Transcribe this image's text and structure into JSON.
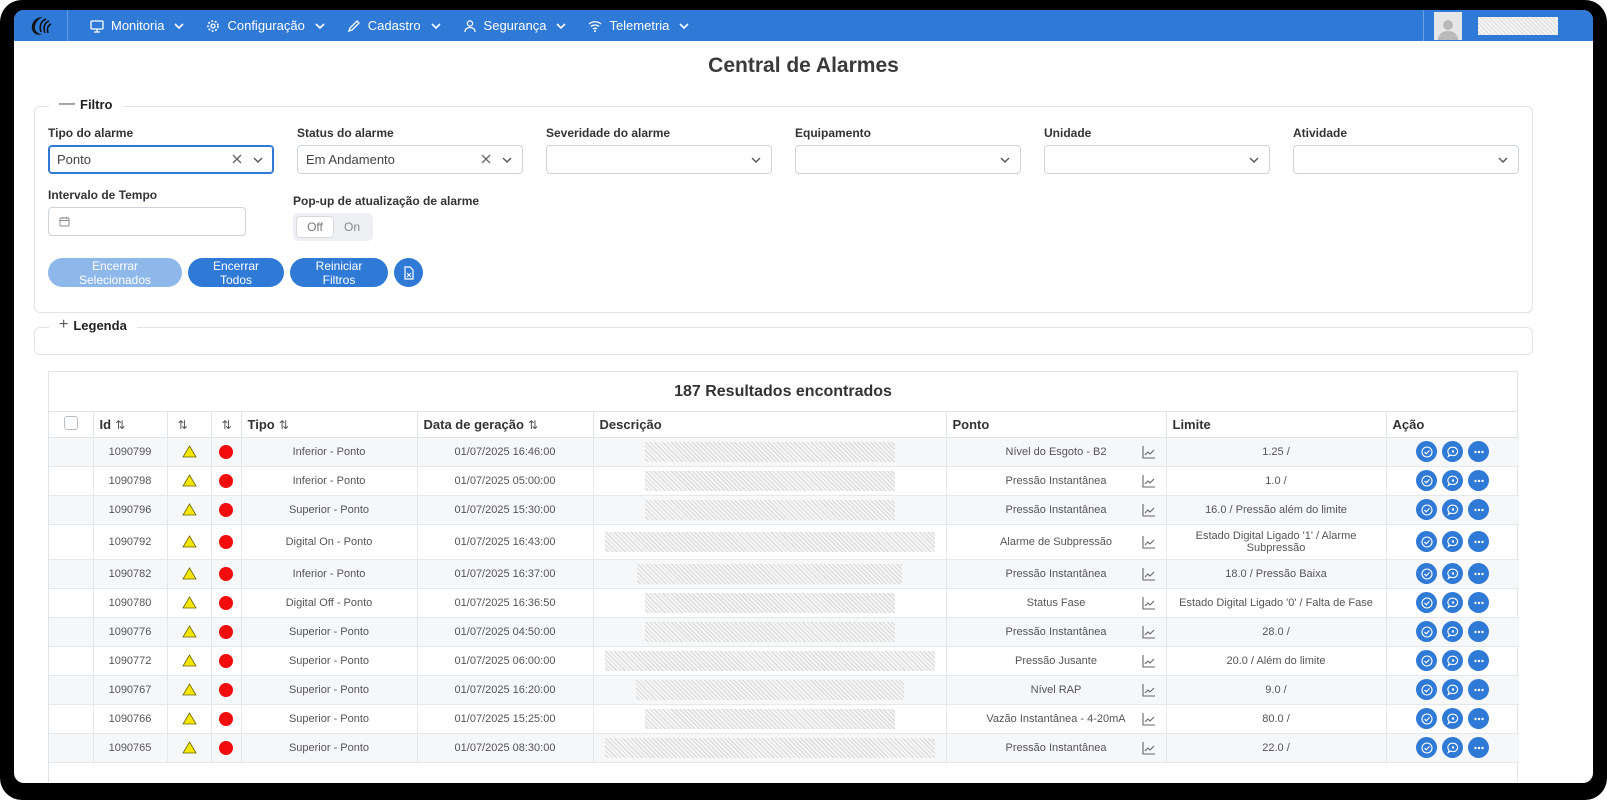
{
  "nav": {
    "items": [
      {
        "label": "Monitoria",
        "icon": "monitor-icon"
      },
      {
        "label": "Configuração",
        "icon": "gear-icon"
      },
      {
        "label": "Cadastro",
        "icon": "pencil-icon"
      },
      {
        "label": "Segurança",
        "icon": "user-icon"
      },
      {
        "label": "Telemetria",
        "icon": "wifi-icon"
      }
    ]
  },
  "page": {
    "title": "Central de Alarmes"
  },
  "filter": {
    "legend": "Filtro",
    "tipo": {
      "label": "Tipo do alarme",
      "value": "Ponto"
    },
    "status": {
      "label": "Status do alarme",
      "value": "Em Andamento"
    },
    "severidade": {
      "label": "Severidade do alarme",
      "value": ""
    },
    "equipamento": {
      "label": "Equipamento",
      "value": ""
    },
    "unidade": {
      "label": "Unidade",
      "value": ""
    },
    "atividade": {
      "label": "Atividade",
      "value": ""
    },
    "intervalo": {
      "label": "Intervalo de Tempo",
      "value": ""
    },
    "popup": {
      "label": "Pop-up de atualização de alarme",
      "off": "Off",
      "on": "On",
      "selected": "Off"
    },
    "buttons": {
      "encerrar_selecionados": "Encerrar Selecionados",
      "encerrar_todos": "Encerrar Todos",
      "reiniciar_filtros": "Reiniciar Filtros"
    }
  },
  "legenda": {
    "legend": "Legenda"
  },
  "table": {
    "results": "187 Resultados encontrados",
    "columns": {
      "id": "Id",
      "tipo": "Tipo",
      "data": "Data de geração",
      "descricao": "Descrição",
      "ponto": "Ponto",
      "limite": "Limite",
      "acao": "Ação"
    },
    "rows": [
      {
        "id": "1090799",
        "tipo": "Inferior - Ponto",
        "data": "01/07/2025 16:46:00",
        "ponto": "Nível do Esgoto - B2",
        "limite": "1.25 /"
      },
      {
        "id": "1090798",
        "tipo": "Inferior - Ponto",
        "data": "01/07/2025 05:00:00",
        "ponto": "Pressão Instantânea",
        "limite": "1.0 /"
      },
      {
        "id": "1090796",
        "tipo": "Superior - Ponto",
        "data": "01/07/2025 15:30:00",
        "ponto": "Pressão Instantânea",
        "limite": "16.0 / Pressão além do limite"
      },
      {
        "id": "1090792",
        "tipo": "Digital On - Ponto",
        "data": "01/07/2025 16:43:00",
        "ponto": "Alarme de Subpressão",
        "limite": "Estado Digital Ligado '1' / Alarme Subpressão"
      },
      {
        "id": "1090782",
        "tipo": "Inferior - Ponto",
        "data": "01/07/2025 16:37:00",
        "ponto": "Pressão Instantânea",
        "limite": "18.0 / Pressão Baixa"
      },
      {
        "id": "1090780",
        "tipo": "Digital Off - Ponto",
        "data": "01/07/2025 16:36:50",
        "ponto": "Status Fase",
        "limite": "Estado Digital Ligado '0' / Falta de Fase"
      },
      {
        "id": "1090776",
        "tipo": "Superior - Ponto",
        "data": "01/07/2025 04:50:00",
        "ponto": "Pressão Instantânea",
        "limite": "28.0 /"
      },
      {
        "id": "1090772",
        "tipo": "Superior - Ponto",
        "data": "01/07/2025 06:00:00",
        "ponto": "Pressão Jusante",
        "limite": "20.0 / Além do limite"
      },
      {
        "id": "1090767",
        "tipo": "Superior - Ponto",
        "data": "01/07/2025 16:20:00",
        "ponto": "Nível RAP",
        "limite": "9.0 /"
      },
      {
        "id": "1090766",
        "tipo": "Superior - Ponto",
        "data": "01/07/2025 15:25:00",
        "ponto": "Vazão Instantânea - 4-20mA",
        "limite": "80.0 /"
      },
      {
        "id": "1090765",
        "tipo": "Superior - Ponto",
        "data": "01/07/2025 08:30:00",
        "ponto": "Pressão Instantânea",
        "limite": "22.0 /"
      }
    ]
  },
  "colors": {
    "primary": "#2f7ad6",
    "primary_disabled": "#8fb8ea",
    "alarm_red": "#f20c0c",
    "warning_yellow": "#f5e600"
  }
}
